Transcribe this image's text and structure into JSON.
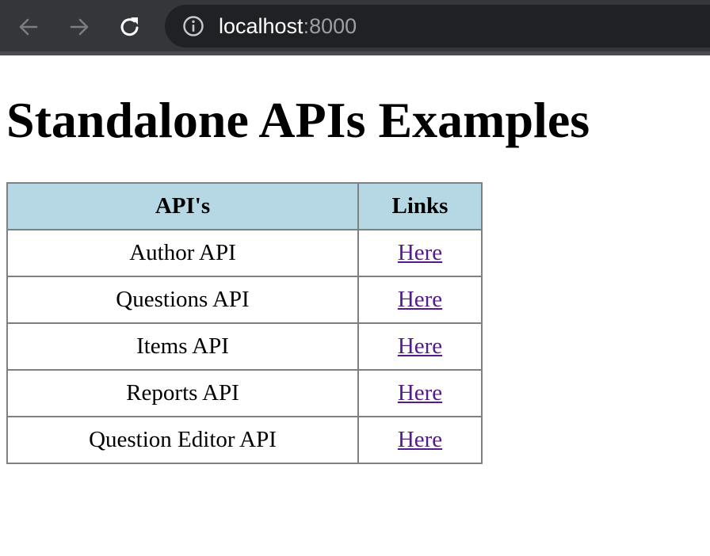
{
  "browser": {
    "url_host": "localhost",
    "url_port": ":8000",
    "icons": {
      "back": "arrow-left-icon",
      "forward": "arrow-right-icon",
      "reload": "reload-icon",
      "site_info": "info-circle-icon"
    }
  },
  "page": {
    "title": "Standalone APIs Examples",
    "table": {
      "headers": [
        "API's",
        "Links"
      ],
      "rows": [
        {
          "api": "Author API",
          "link": "Here"
        },
        {
          "api": "Questions API",
          "link": "Here"
        },
        {
          "api": "Items API",
          "link": "Here"
        },
        {
          "api": "Reports API",
          "link": "Here"
        },
        {
          "api": "Question Editor API",
          "link": "Here"
        }
      ]
    }
  },
  "colors": {
    "header_bg": "#b5d8e4",
    "visited_link": "#551a8b",
    "toolbar_bg": "#35363a",
    "omnibox_bg": "#202124"
  }
}
